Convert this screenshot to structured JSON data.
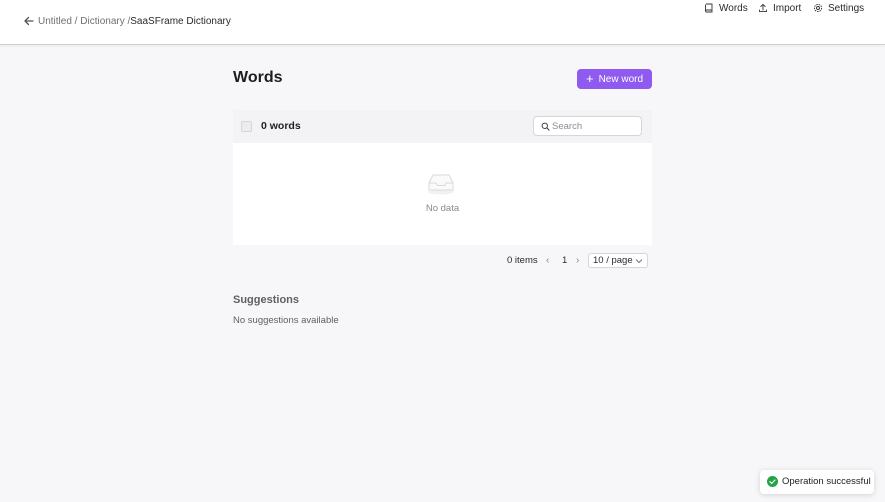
{
  "header": {
    "breadcrumb": {
      "items": [
        "Untitled /",
        "Dictionary /",
        "SaaSFrame Dictionary"
      ]
    },
    "nav": [
      {
        "label": "Words",
        "icon": "book-icon"
      },
      {
        "label": "Import",
        "icon": "upload-icon"
      },
      {
        "label": "Settings",
        "icon": "gear-icon"
      }
    ]
  },
  "main": {
    "title": "Words",
    "new_button_label": "New word",
    "table": {
      "count_label": "0 words",
      "search_placeholder": "Search",
      "empty_text": "No data"
    },
    "pagination": {
      "total_label": "0 items",
      "current_page": "1",
      "page_size": "10 / page"
    },
    "suggestions": {
      "title": "Suggestions",
      "empty_text": "No suggestions available"
    }
  },
  "toast": {
    "message": "Operation successful",
    "status": "success",
    "color": "#22a447"
  },
  "colors": {
    "accent": "#8e5af0",
    "background": "#f7f7f9"
  }
}
